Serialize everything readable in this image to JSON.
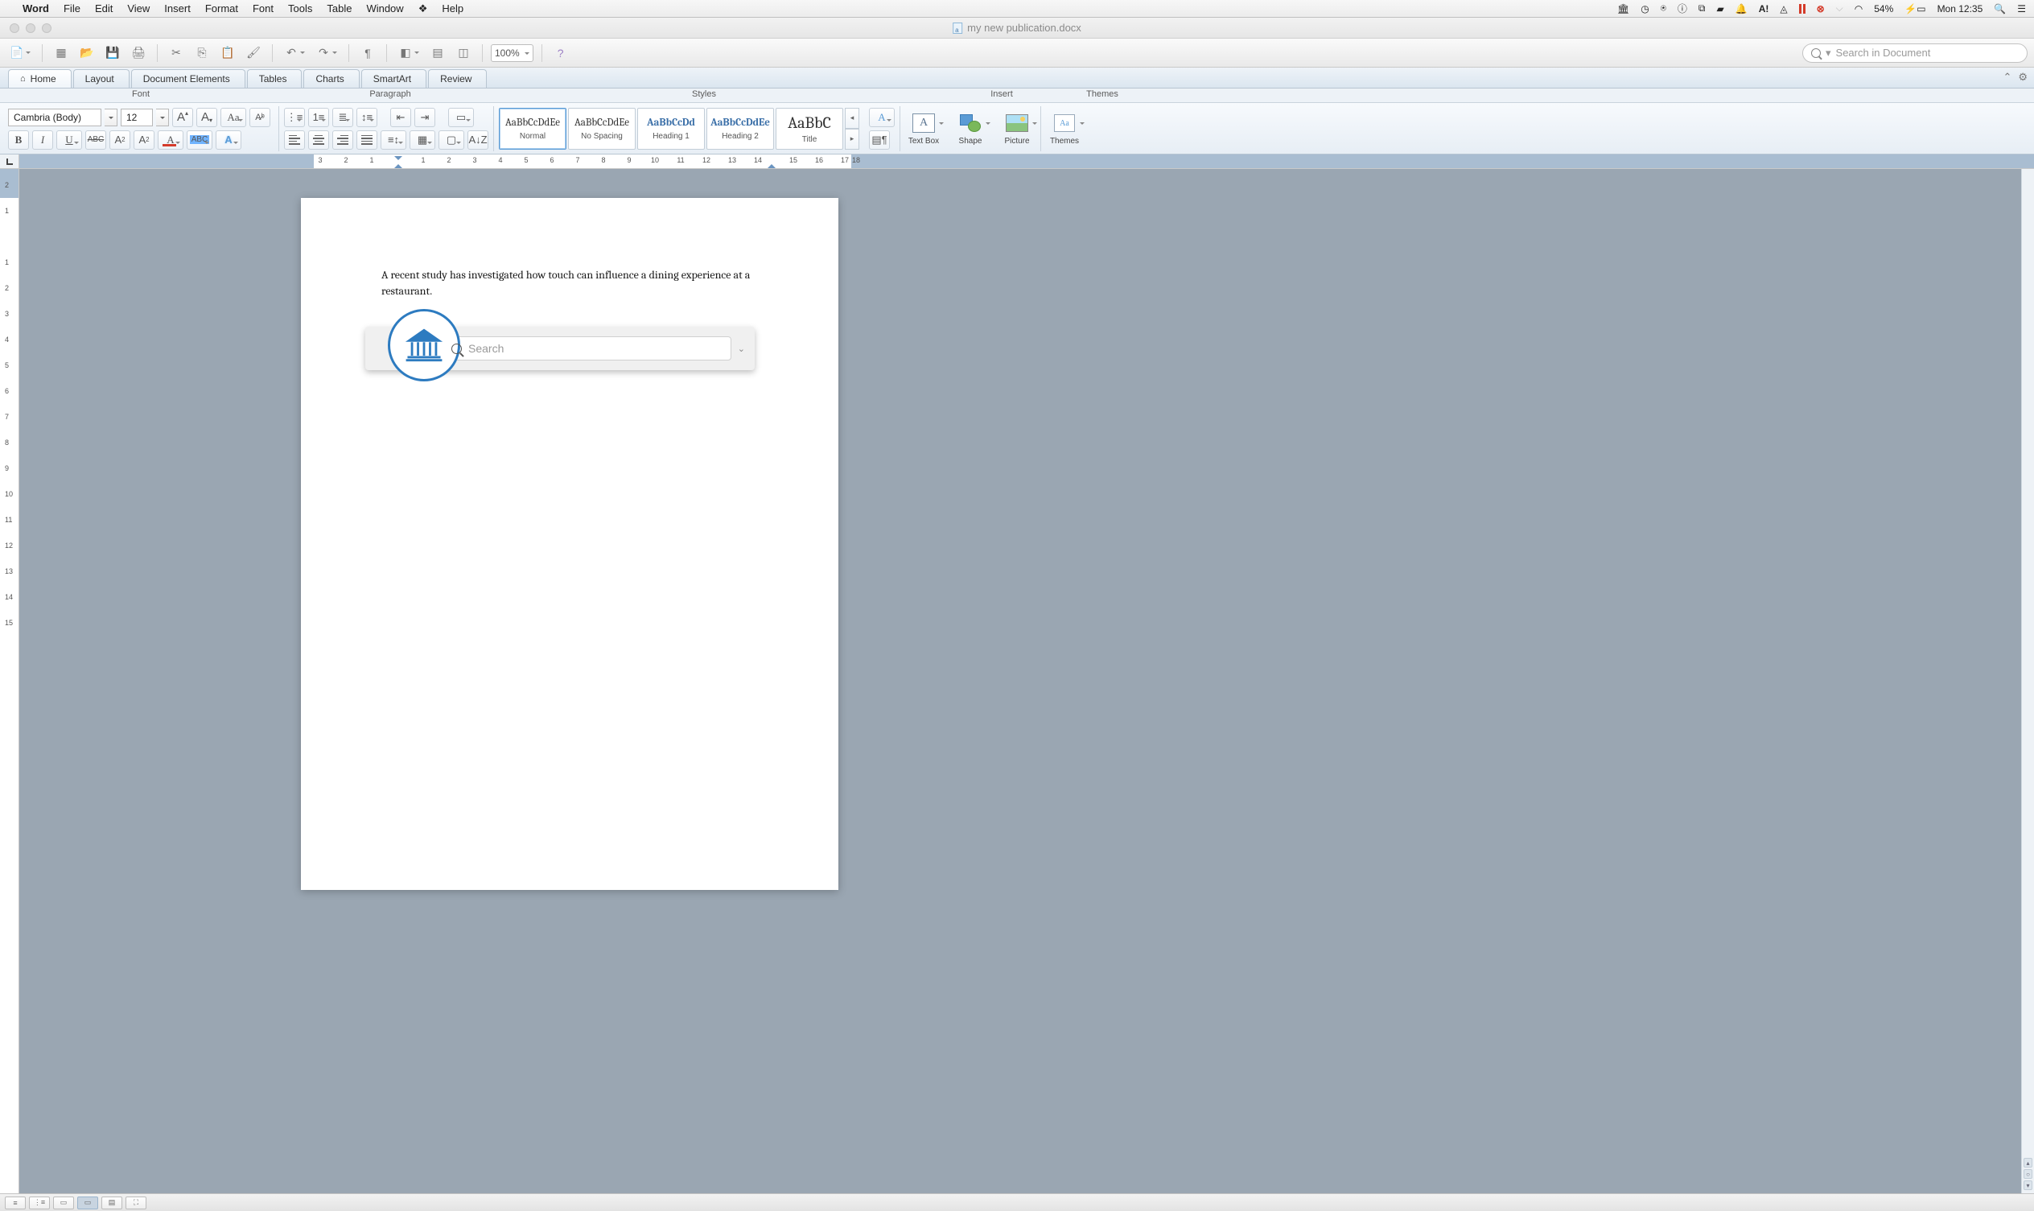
{
  "menubar": {
    "app": "Word",
    "items": [
      "File",
      "Edit",
      "View",
      "Insert",
      "Format",
      "Font",
      "Tools",
      "Table",
      "Window"
    ],
    "help": "Help",
    "battery": "54%",
    "clock": "Mon 12:35"
  },
  "window": {
    "title": "my new publication.docx"
  },
  "toolbar": {
    "zoom": "100%",
    "search_placeholder": "Search in Document"
  },
  "tabs": {
    "items": [
      "Home",
      "Layout",
      "Document Elements",
      "Tables",
      "Charts",
      "SmartArt",
      "Review"
    ],
    "active": 0
  },
  "groups": {
    "font": "Font",
    "paragraph": "Paragraph",
    "styles": "Styles",
    "insert": "Insert",
    "themes": "Themes"
  },
  "font": {
    "name": "Cambria (Body)",
    "size": "12"
  },
  "styles": {
    "preview": "AaBbCcDdEe",
    "preview_short": "AaBbCcDd",
    "preview_big": "AaBbC",
    "items": [
      "Normal",
      "No Spacing",
      "Heading 1",
      "Heading 2",
      "Title"
    ]
  },
  "insert": {
    "textbox": "Text Box",
    "shape": "Shape",
    "picture": "Picture",
    "themes": "Themes"
  },
  "ruler_h": [
    "3",
    "2",
    "1",
    "1",
    "2",
    "3",
    "4",
    "5",
    "6",
    "7",
    "8",
    "9",
    "10",
    "11",
    "12",
    "13",
    "14",
    "15",
    "16",
    "17",
    "18"
  ],
  "ruler_v": [
    "2",
    "1",
    "1",
    "2",
    "3",
    "4",
    "5",
    "6",
    "7",
    "8",
    "9",
    "10",
    "11",
    "12",
    "13",
    "14",
    "15"
  ],
  "document": {
    "text": "A recent study has investigated how touch can influence a dining experience at a restaurant."
  },
  "widget": {
    "placeholder": "Search"
  }
}
